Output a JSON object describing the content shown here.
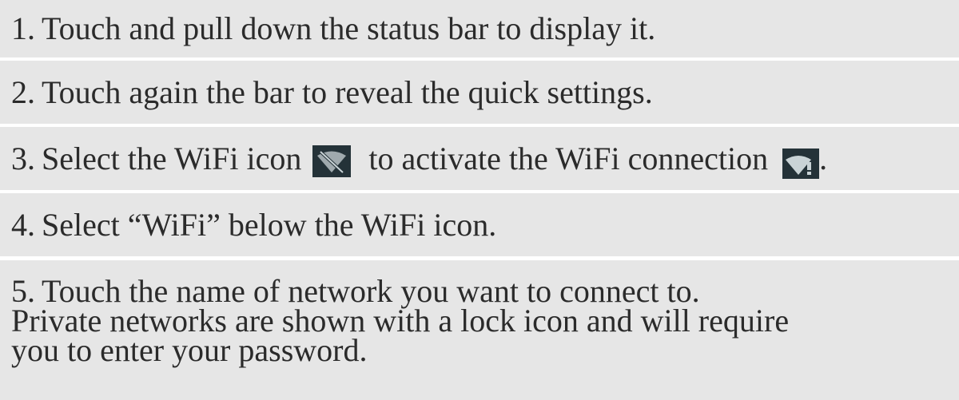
{
  "steps": [
    {
      "number": "1.",
      "text": "Touch and pull down the status bar to display it."
    },
    {
      "number": "2.",
      "text": "Touch again the bar to reveal the quick settings."
    },
    {
      "number": "3.",
      "text_before_icon": "Select the WiFi icon",
      "icon_1": "wifi-off-icon",
      "text_between_icons": "to activate the WiFi connection",
      "icon_2": "wifi-warning-icon",
      "text_after_icon": "."
    },
    {
      "number": "4.",
      "text": "Select “WiFi” below the WiFi icon."
    },
    {
      "number": "5.",
      "line_1": "Touch the name of network you want to connect to.",
      "line_2": "Private networks are shown with a lock icon and will require",
      "line_3": "you to enter your password."
    }
  ],
  "colors": {
    "row_background": "#e6e6e6",
    "separator": "#ffffff",
    "text": "#2b2b2b",
    "icon_background": "#243238",
    "icon_glyph": "#c9d3d6"
  }
}
